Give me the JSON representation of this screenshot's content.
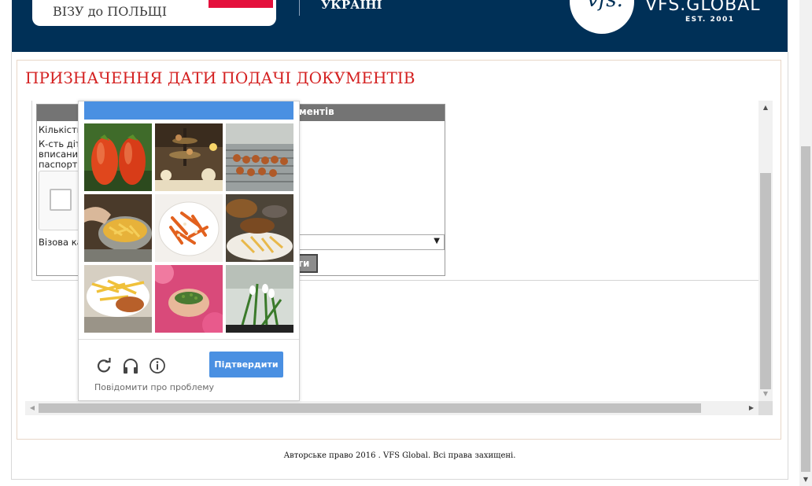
{
  "header": {
    "visa_card_text": "ВІЗУ до ПОЛЬЩІ",
    "ukraine_text": "УКРАЇНІ",
    "logo_glyph": "vfs.",
    "brand_name": "VFS.GLOBAL",
    "brand_est": "EST. 2001"
  },
  "main": {
    "page_title": "ПРИЗНАЧЕННЯ ДАТИ ПОДАЧІ ДОКУМЕНТІВ",
    "form": {
      "header_fragment": "ументів",
      "label_count": "Кількість",
      "label_children_1": "К-сть діт",
      "label_children_2": "вписаних",
      "label_children_3": "паспорт",
      "label_visa_cat": "Візова ка",
      "button_fragment": "ти"
    }
  },
  "captcha": {
    "verify_label": "Підтвердити",
    "report_label": "Повідомити про проблему",
    "icons": [
      "refresh-icon",
      "headphones-icon",
      "info-icon"
    ],
    "tiles": [
      "tomatoes",
      "tea-party",
      "grilled-skewers",
      "fries-basket",
      "pasta-plate",
      "burger-and-fries",
      "fries-plate",
      "hands-with-seeds",
      "snowdrops"
    ],
    "accent_color": "#4a90e2"
  },
  "footer": {
    "copyright": "Авторське право 2016 . VFS Global. Всі права захищені."
  }
}
